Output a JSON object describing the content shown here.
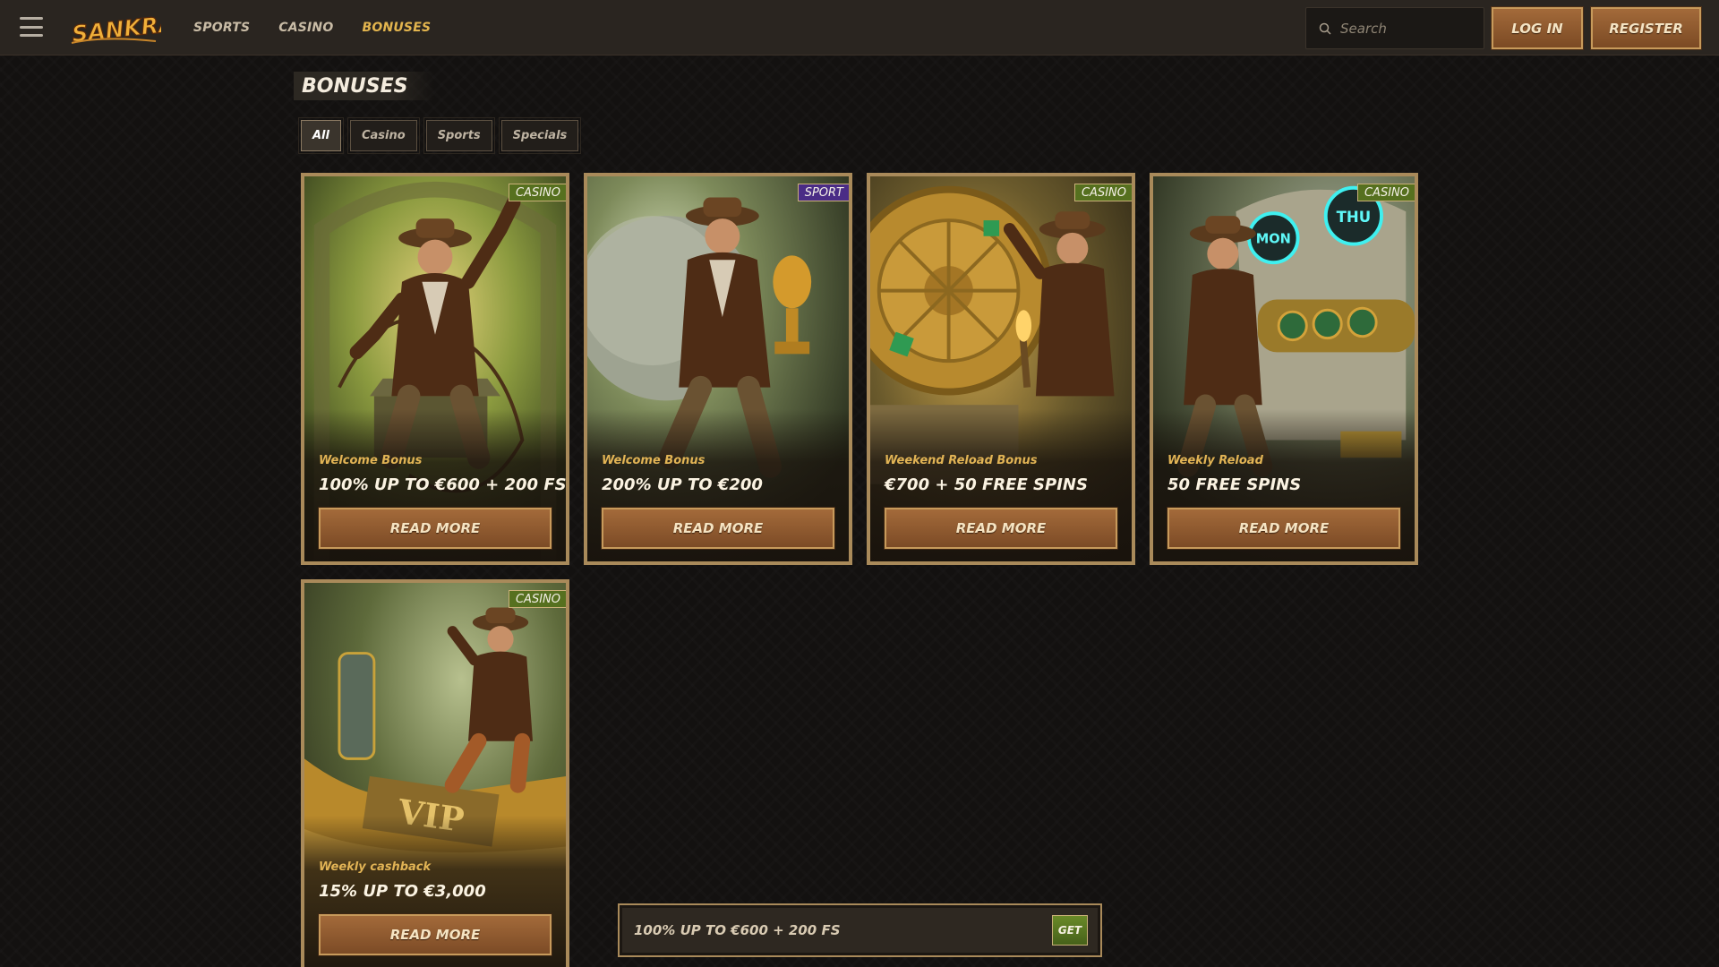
{
  "header": {
    "logo_text": "SANKRA",
    "nav": [
      {
        "label": "SPORTS",
        "active": false
      },
      {
        "label": "CASINO",
        "active": false
      },
      {
        "label": "BONUSES",
        "active": true
      }
    ],
    "search_placeholder": "Search",
    "login_label": "LOG IN",
    "register_label": "REGISTER"
  },
  "page": {
    "title": "BONUSES",
    "filters": [
      {
        "label": "All",
        "active": true
      },
      {
        "label": "Casino",
        "active": false
      },
      {
        "label": "Sports",
        "active": false
      },
      {
        "label": "Specials",
        "active": false
      }
    ]
  },
  "cards": [
    {
      "badge": "CASINO",
      "subtitle": "Welcome Bonus",
      "offer": "100% UP TO €600 + 200 FS",
      "button": "READ MORE",
      "art": "adventurer-whip"
    },
    {
      "badge": "SPORT",
      "subtitle": "Welcome Bonus",
      "offer": "200% UP TO €200",
      "button": "READ MORE",
      "art": "adventurer-trophy"
    },
    {
      "badge": "CASINO",
      "subtitle": "Weekend Reload Bonus",
      "offer": "€700 + 50 FREE SPINS",
      "button": "READ MORE",
      "art": "adventurer-wheel"
    },
    {
      "badge": "CASINO",
      "subtitle": "Weekly Reload",
      "offer": "50 FREE SPINS",
      "button": "READ MORE",
      "art": "adventurer-skull",
      "art_text": [
        "MON",
        "THU"
      ]
    },
    {
      "badge": "CASINO",
      "subtitle": "Weekly cashback",
      "offer": "15% UP TO €3,000",
      "button": "READ MORE",
      "art": "adventurer-vip",
      "art_text": [
        "VIP"
      ]
    }
  ],
  "promo_bar": {
    "text": "100% UP TO €600 + 200 FS",
    "button": "GET"
  },
  "colors": {
    "background": "#131110",
    "header": "#2a2520",
    "accent_gold": "#e3b54e",
    "button_brown": "#8f5a2f",
    "casino_badge": "#56701f",
    "sport_badge": "#4a2c86"
  }
}
